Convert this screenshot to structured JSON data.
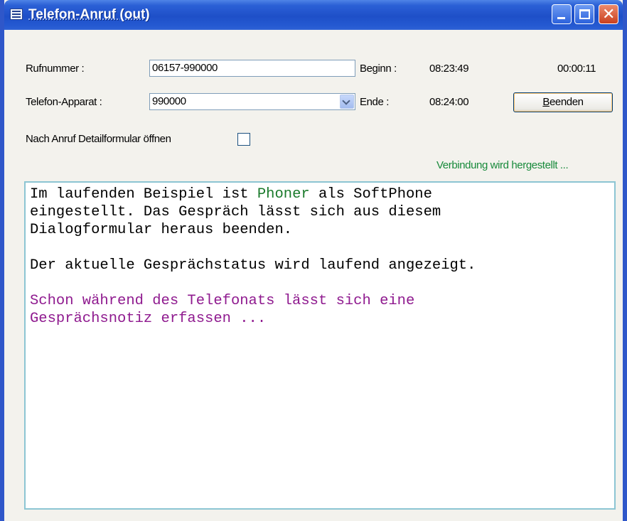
{
  "window": {
    "title": "Telefon-Anruf (out)",
    "close_glyph": "✕"
  },
  "form": {
    "rufnummer_label": "Rufnummer :",
    "rufnummer_value": "06157-990000",
    "apparat_label": "Telefon-Apparat :",
    "apparat_value": "990000",
    "beginn_label": "Beginn :",
    "beginn_time": "08:23:49",
    "duration": "00:00:11",
    "ende_label": "Ende :",
    "ende_time": "08:24:00",
    "beenden_button_prefix": "",
    "beenden_button_mnemonic": "B",
    "beenden_button_rest": "eenden",
    "detail_label": "Nach Anruf Detailformular öffnen",
    "detail_checked": false,
    "status": "Verbindung wird hergestellt ..."
  },
  "notes": {
    "line1_a": "Im laufenden Beispiel ist ",
    "line1_highlight": "Phoner",
    "line1_b": " als SoftPhone",
    "line2": "eingestellt. Das Gespräch lässt sich aus diesem",
    "line3": "Dialogformular heraus beenden.",
    "line5": "Der aktuelle Gesprächstatus wird laufend angezeigt.",
    "line7": "Schon während des Telefonats lässt sich eine",
    "line8": "Gesprächsnotiz erfassen ..."
  },
  "colors": {
    "titlebar": "#1e4fc8",
    "status_text": "#188a3b",
    "highlight_green": "#1a7a2b",
    "note_purple": "#8f1a8f",
    "memo_border": "#8cc5d3"
  },
  "icons": {
    "window_icon": "form-icon",
    "minimize": "minimize-icon",
    "maximize": "maximize-icon",
    "close": "close-icon",
    "combo": "chevron-down-icon"
  }
}
